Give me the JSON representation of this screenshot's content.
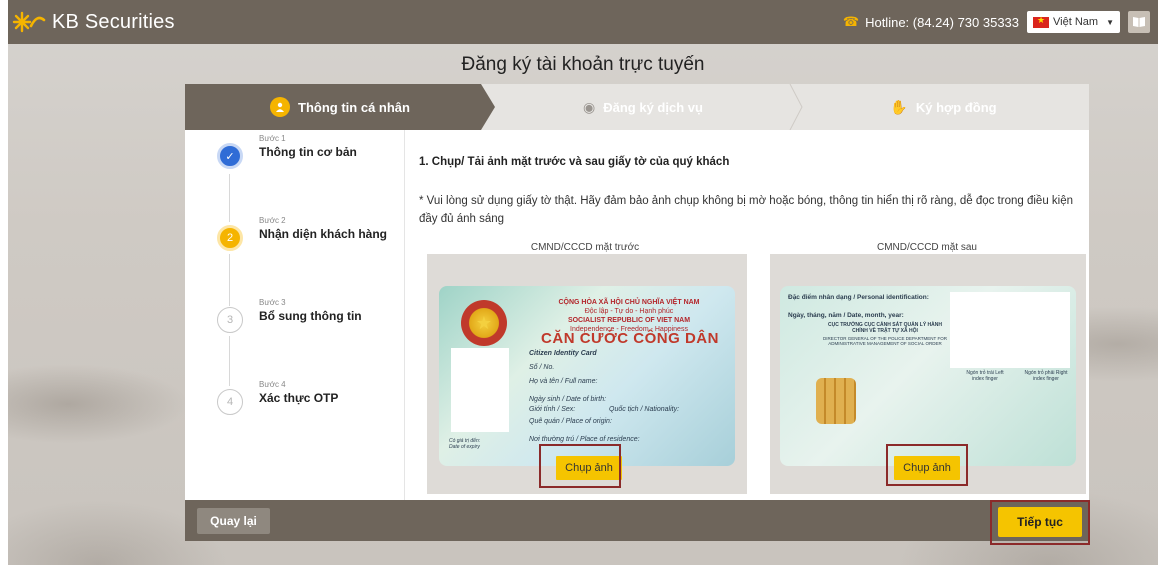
{
  "header": {
    "brand": "KB Securities",
    "hotline": "Hotline: (84.24) 730 35333",
    "language": "Việt Nam",
    "icons": {
      "logo": "kb-star-logo-icon",
      "phone": "phone-icon",
      "flag": "vietnam-flag-icon",
      "guide": "book-icon"
    }
  },
  "page": {
    "title": "Đăng ký tài khoản trực tuyến"
  },
  "tabs": [
    {
      "label": "Thông tin cá nhân",
      "icon": "user-icon",
      "active": true
    },
    {
      "label": "Đăng ký dịch vụ",
      "icon": "service-icon",
      "active": false
    },
    {
      "label": "Ký hợp đồng",
      "icon": "handshake-icon",
      "active": false
    }
  ],
  "steps": [
    {
      "number": "Bước 1",
      "name": "Thông tin cơ bản",
      "marker": "✓",
      "status": "done"
    },
    {
      "number": "Bước 2",
      "name": "Nhận diện khách hàng",
      "marker": "2",
      "status": "active"
    },
    {
      "number": "Bước 3",
      "name": "Bổ sung thông tin",
      "marker": "3",
      "status": "pending"
    },
    {
      "number": "Bước 4",
      "name": "Xác thực OTP",
      "marker": "4",
      "status": "pending"
    }
  ],
  "content": {
    "title": "1. Chụp/ Tải ảnh mặt trước và sau giấy tờ của quý khách",
    "note": "* Vui lòng sử dụng giấy tờ thật. Hãy đảm bảo ảnh chụp không bị mờ hoặc bóng, thông tin hiển thị rõ ràng, dễ đọc trong điều kiện đầy đủ ánh sáng",
    "front": {
      "label": "CMND/CCCD mặt trước",
      "button": "Chụp ảnh",
      "card": {
        "country": "CỘNG HÒA XÃ HỘI CHỦ NGHĨA VIỆT NAM",
        "motto": "Độc lập - Tự do - Hạnh phúc",
        "country_en": "SOCIALIST REPUBLIC OF VIET NAM",
        "motto_en": "Independence - Freedom - Happiness",
        "title": "CĂN CƯỚC CÔNG DÂN",
        "subtitle": "Citizen Identity Card",
        "f_no": "Số / No.",
        "f_name": "Họ và tên / Full name:",
        "f_dob": "Ngày sinh / Date of birth:",
        "f_sex": "Giới tính / Sex:",
        "f_nat": "Quốc tịch / Nationality:",
        "f_origin": "Quê quán / Place of origin:",
        "f_res": "Nơi thường trú / Place of residence:",
        "f_exp": "Có giá trị đến: Date of expiry"
      }
    },
    "back": {
      "label": "CMND/CCCD mặt sau",
      "button": "Chụp ảnh",
      "card": {
        "l1": "Đặc điểm nhân dạng / Personal identification:",
        "l2": "Ngày, tháng, năm / Date, month, year:",
        "l3": "CỤC TRƯỞNG CỤC CẢNH SÁT QUẢN LÝ HÀNH CHÍNH VỀ TRẬT TỰ XÃ HỘI",
        "l4": "DIRECTOR GENERAL OF THE POLICE DEPARTMENT FOR ADMINISTRATIVE MANAGEMENT OF SOCIAL ORDER",
        "left_finger": "Ngón trỏ trái Left index finger",
        "right_finger": "Ngón trỏ phải Right index finger"
      }
    }
  },
  "footer": {
    "back": "Quay lại",
    "next": "Tiếp tục"
  }
}
